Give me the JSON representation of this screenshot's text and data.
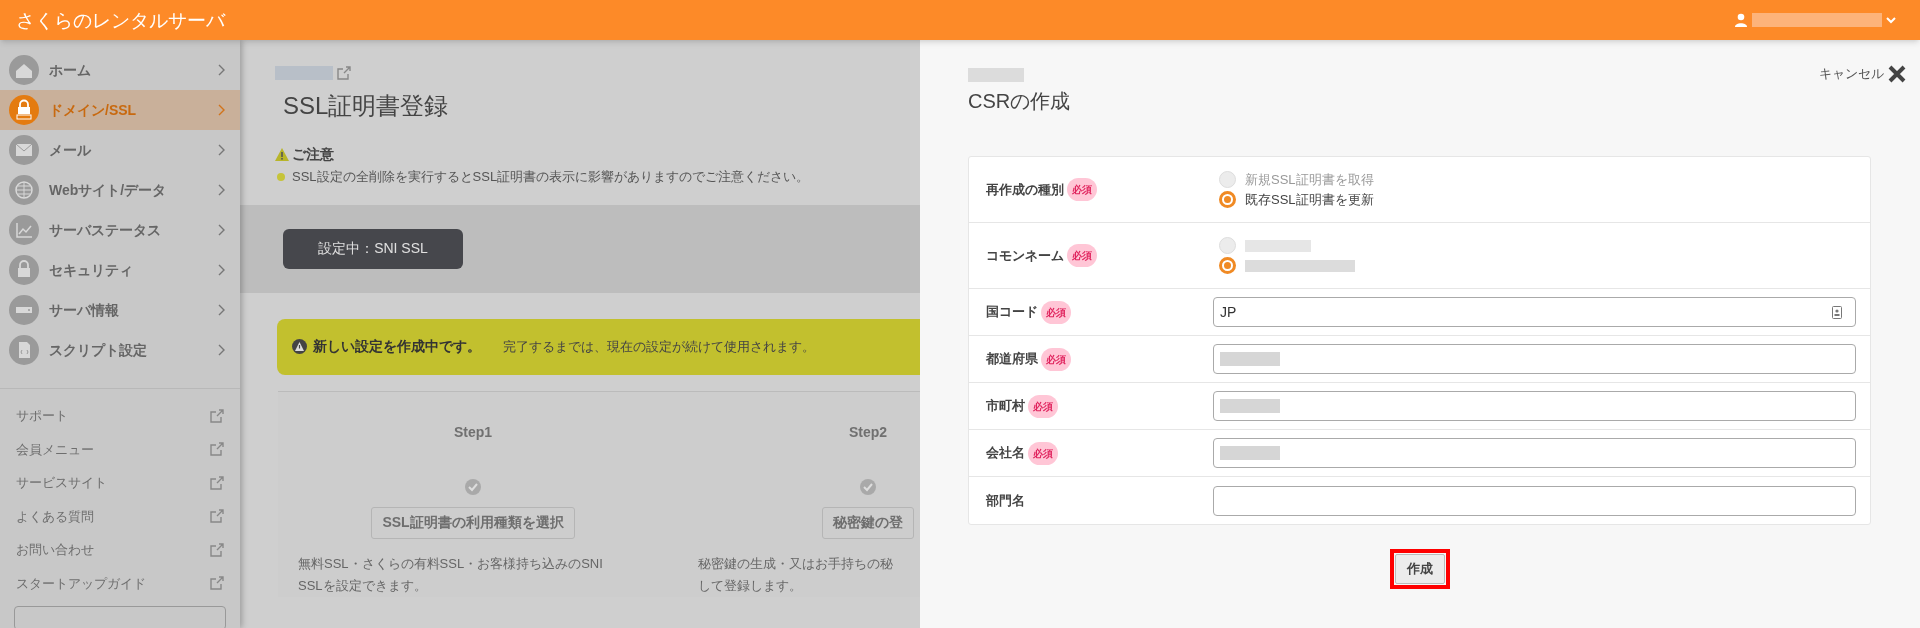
{
  "header": {
    "title": "さくらのレンタルサーバ",
    "user_redacted": true
  },
  "sidebar": {
    "nav_items": [
      {
        "label": "ホーム",
        "selected": false
      },
      {
        "label": "ドメイン/SSL",
        "selected": true
      },
      {
        "label": "メール",
        "selected": false
      },
      {
        "label": "Webサイト/データ",
        "selected": false
      },
      {
        "label": "サーバステータス",
        "selected": false
      },
      {
        "label": "セキュリティ",
        "selected": false
      },
      {
        "label": "サーバ情報",
        "selected": false
      },
      {
        "label": "スクリプト設定",
        "selected": false
      }
    ],
    "links": [
      {
        "label": "サポート"
      },
      {
        "label": "会員メニュー"
      },
      {
        "label": "サービスサイト"
      },
      {
        "label": "よくある質問"
      },
      {
        "label": "お問い合わせ"
      },
      {
        "label": "スタートアップガイド"
      }
    ]
  },
  "main": {
    "page_title": "SSL証明書登録",
    "notice": {
      "title": "ご注意",
      "text": "SSL設定の全削除を実行するとSSL証明書の表示に影響がありますのでご注意ください。"
    },
    "current_setting": "設定中：SNI SSL",
    "banner": {
      "title": "新しい設定を作成中です。",
      "text": "完了するまでは、現在の設定が続けて使用されます。"
    },
    "steps": [
      {
        "step": "Step1",
        "button": "SSL証明書の利用種類を選択",
        "description": [
          "無料SSL・さくらの有料SSL・お客様持ち込みのSNI",
          "SSLを設定できます。"
        ]
      },
      {
        "step": "Step2",
        "button": "秘密鍵の登",
        "description": [
          "秘密鍵の生成・又はお手持ちの秘",
          "して登録します。"
        ]
      }
    ]
  },
  "panel": {
    "title": "CSRの作成",
    "cancel": "キャンセル",
    "rows": [
      {
        "kind": "radio",
        "label": "再作成の種別",
        "required": "必須",
        "options": [
          {
            "label": "新規SSL証明書を取得",
            "selected": false
          },
          {
            "label": "既存SSL証明書を更新",
            "selected": true
          }
        ]
      },
      {
        "kind": "radio",
        "label": "コモンネーム",
        "required": "必須",
        "options": [
          {
            "redacted": true,
            "selected": false
          },
          {
            "redacted": true,
            "selected": true
          }
        ]
      },
      {
        "kind": "input",
        "label": "国コード",
        "required": "必須",
        "value": "JP"
      },
      {
        "kind": "input",
        "label": "都道府県",
        "required": "必須",
        "redacted": true
      },
      {
        "kind": "input",
        "label": "市町村",
        "required": "必須",
        "redacted": true
      },
      {
        "kind": "input",
        "label": "会社名",
        "required": "必須",
        "redacted": true
      },
      {
        "kind": "input",
        "label": "部門名"
      }
    ],
    "submit": "作成"
  }
}
